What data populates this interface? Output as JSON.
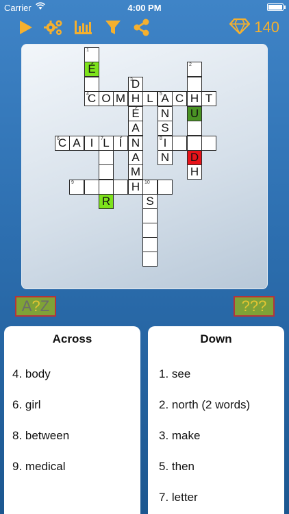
{
  "status": {
    "carrier": "Carrier",
    "time": "4:00 PM"
  },
  "toolbar": {
    "gem_count": "140"
  },
  "colors": {
    "accent": "#f5b02e",
    "board_green": "#7ee31c",
    "board_dark_green": "#4a9324",
    "board_red": "#e8131a"
  },
  "icons": [
    "play-icon",
    "gears-icon",
    "bar-chart-icon",
    "filter-icon",
    "share-icon",
    "diamond-icon"
  ],
  "board": {
    "letters": {
      "e_acute": "É",
      "d1": "D",
      "h1": "H",
      "e2": "É",
      "a1": "A",
      "n1": "N",
      "a2": "A",
      "m1": "M",
      "h2": "H",
      "c1": "C",
      "o1": "O",
      "m2": "M",
      "hh": "H",
      "l1": "L",
      "a3": "A",
      "c2": "C",
      "h3": "H",
      "t1": "T",
      "n2": "N",
      "s1": "S",
      "i1": "I",
      "n3": "N",
      "u1": "U",
      "d2": "D",
      "h4": "H",
      "c3": "C",
      "a4": "A",
      "i2": "I",
      "l2": "L",
      "i_acute": "Í",
      "n4": "N",
      "r1": "R",
      "s2": "S"
    },
    "numbers": {
      "n1": "1",
      "n2": "2",
      "n3": "3",
      "n4": "4",
      "n5": "5",
      "n6": "6",
      "n7": "7",
      "n8": "8",
      "n9": "9",
      "n10": "10"
    }
  },
  "hints": {
    "left": {
      "a": "A",
      "q": "?",
      "z": "Z"
    },
    "right": {
      "q1": "?",
      "q2": "?",
      "q3": "?"
    }
  },
  "across": {
    "title": "Across",
    "clues": [
      "4. body",
      "6. girl",
      "8. between",
      "9. medical"
    ]
  },
  "down": {
    "title": "Down",
    "clues": [
      "1. see",
      "2. north (2 words)",
      "3. make",
      "5. then",
      "7. letter"
    ]
  }
}
